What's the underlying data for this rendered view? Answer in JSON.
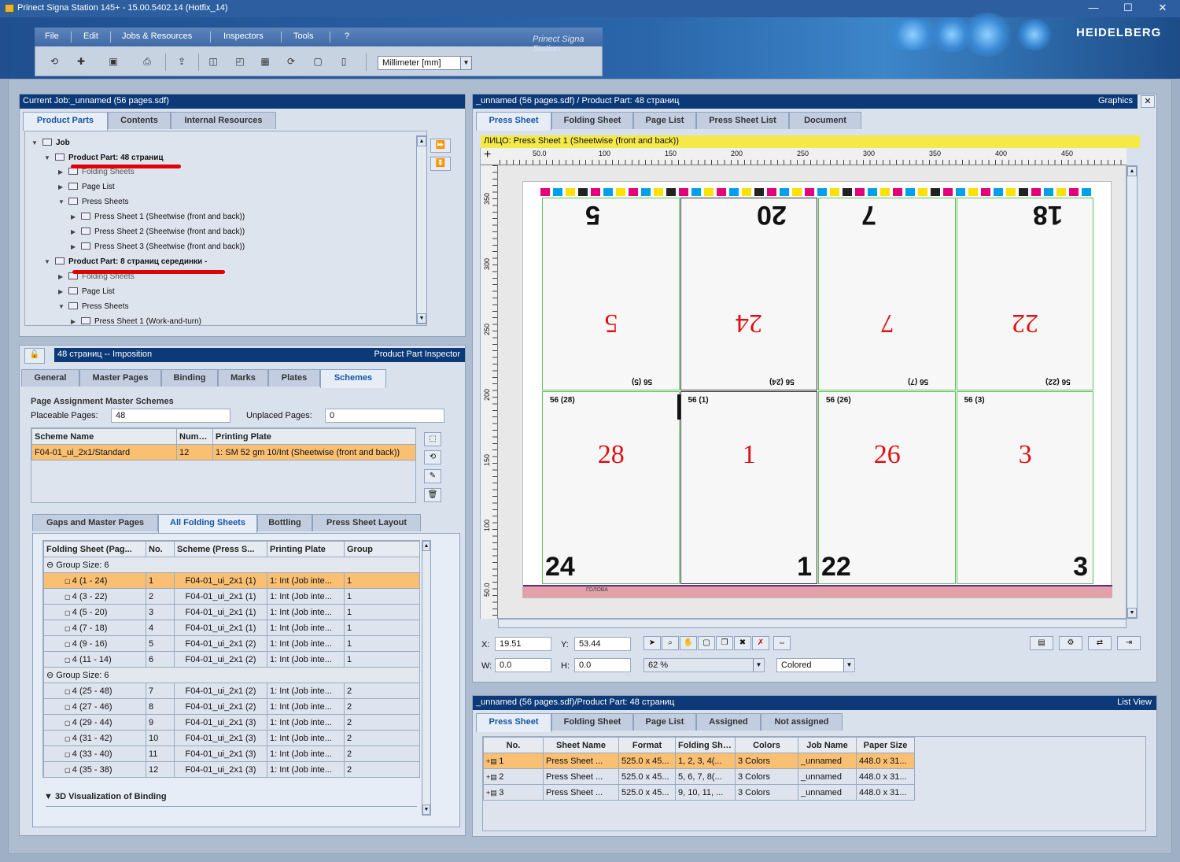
{
  "window": {
    "title": "Prinect Signa Station 145+  -  15.00.5402.14 (Hotfix_14)",
    "minimize": "—",
    "maximize": "☐",
    "close": "✕"
  },
  "brand": {
    "logo": "HEIDELBERG",
    "tagline": "Prinect Signa Station"
  },
  "menu": {
    "items": [
      "File",
      "Edit",
      "Jobs & Resources",
      "Inspectors",
      "Tools",
      "?"
    ]
  },
  "toolbar": {
    "units": "Millimeter  [mm]"
  },
  "job_panel": {
    "title": "Current Job:_unnamed (56 pages.sdf)",
    "tabs": [
      "Product Parts",
      "Contents",
      "Internal Resources"
    ],
    "tree": [
      {
        "label": "Job"
      },
      {
        "label": "Product Part: 48 страниц"
      },
      {
        "label": "Folding Sheets"
      },
      {
        "label": "Page List"
      },
      {
        "label": "Press Sheets"
      },
      {
        "label": "Press Sheet 1 (Sheetwise (front and back))"
      },
      {
        "label": "Press Sheet 2 (Sheetwise (front and back))"
      },
      {
        "label": "Press Sheet 3 (Sheetwise (front and back))"
      },
      {
        "label": "Product Part: 8 страниц серединки -"
      },
      {
        "label": "Folding Sheets"
      },
      {
        "label": "Page List"
      },
      {
        "label": "Press Sheets"
      },
      {
        "label": "Press Sheet 1 (Work-and-turn)"
      }
    ]
  },
  "inspector": {
    "title": "48 страниц -- Imposition",
    "right_title": "Product Part Inspector",
    "tabs": [
      "General",
      "Master Pages",
      "Binding",
      "Marks",
      "Plates",
      "Schemes"
    ],
    "section": "Page Assignment  Master Schemes",
    "placeable_label": "Placeable Pages:",
    "placeable_value": "48",
    "unplaced_label": "Unplaced Pages:",
    "unplaced_value": "0",
    "scheme_headers": [
      "Scheme Name",
      "Number",
      "Printing Plate"
    ],
    "scheme_rows": [
      [
        "F04-01_ui_2x1/Standard",
        "12",
        "1: SM 52 gm 10/Int (Sheetwise (front and back))"
      ]
    ],
    "subtabs": [
      "Gaps and Master Pages",
      "All Folding Sheets",
      "Bottling",
      "Press Sheet Layout"
    ],
    "fs_headers": [
      "Folding Sheet (Pag...",
      "No.",
      "Scheme (Press S...",
      "Printing Plate",
      "Group"
    ],
    "group1": "Group Size: 6",
    "group2": "Group Size: 6",
    "fs_rows1": [
      [
        "4 (1 - 24)",
        "1",
        "F04-01_ui_2x1  (1)",
        "1: Int (Job inte...",
        "1"
      ],
      [
        "4 (3 - 22)",
        "2",
        "F04-01_ui_2x1  (1)",
        "1: Int (Job inte...",
        "1"
      ],
      [
        "4 (5 - 20)",
        "3",
        "F04-01_ui_2x1  (1)",
        "1: Int (Job inte...",
        "1"
      ],
      [
        "4 (7 - 18)",
        "4",
        "F04-01_ui_2x1  (1)",
        "1: Int (Job inte...",
        "1"
      ],
      [
        "4 (9 - 16)",
        "5",
        "F04-01_ui_2x1  (2)",
        "1: Int (Job inte...",
        "1"
      ],
      [
        "4 (11 - 14)",
        "6",
        "F04-01_ui_2x1  (2)",
        "1: Int (Job inte...",
        "1"
      ]
    ],
    "fs_rows2": [
      [
        "4 (25 - 48)",
        "7",
        "F04-01_ui_2x1  (2)",
        "1: Int (Job inte...",
        "2"
      ],
      [
        "4 (27 - 46)",
        "8",
        "F04-01_ui_2x1  (2)",
        "1: Int (Job inte...",
        "2"
      ],
      [
        "4 (29 - 44)",
        "9",
        "F04-01_ui_2x1  (3)",
        "1: Int (Job inte...",
        "2"
      ],
      [
        "4 (31 - 42)",
        "10",
        "F04-01_ui_2x1  (3)",
        "1: Int (Job inte...",
        "2"
      ],
      [
        "4 (33 - 40)",
        "11",
        "F04-01_ui_2x1  (3)",
        "1: Int (Job inte...",
        "2"
      ],
      [
        "4 (35 - 38)",
        "12",
        "F04-01_ui_2x1  (3)",
        "1: Int (Job inte...",
        "2"
      ]
    ],
    "viz_label": "3D Visualization of Binding"
  },
  "graphics": {
    "title": "_unnamed (56 pages.sdf) / Product Part: 48 страниц",
    "right_title": "Graphics",
    "tabs": [
      "Press Sheet",
      "Folding Sheet",
      "Page List",
      "Press Sheet List",
      "Document"
    ],
    "infobar": "ЛИЦО:  Press Sheet 1 (Sheetwise (front and back))",
    "ruler_h": [
      "50.0",
      "100",
      "150",
      "200",
      "250",
      "300",
      "350",
      "400",
      "450"
    ],
    "ruler_v": [
      "350",
      "300",
      "250",
      "200",
      "150",
      "100",
      "50.0"
    ],
    "top_pages": [
      {
        "corner": "5",
        "center": "5",
        "foot": "56 (5)"
      },
      {
        "corner": "20",
        "center": "24",
        "foot": "56 (24)"
      },
      {
        "corner": "7",
        "center": "7",
        "foot": "56 (7)"
      },
      {
        "corner": "18",
        "center": "22",
        "foot": "56 (22)"
      }
    ],
    "bottom_pages": [
      {
        "head": "56 (28)",
        "center": "28",
        "corner": "24"
      },
      {
        "head": "56 (1)",
        "center": "1",
        "corner": "1"
      },
      {
        "head": "56 (26)",
        "center": "26",
        "corner": "22"
      },
      {
        "head": "56 (3)",
        "center": "3",
        "corner": "3"
      }
    ],
    "gripper": "ГОЛОВА",
    "x_label": "X:",
    "x_value": "19.51",
    "y_label": "Y:",
    "y_value": "53.44",
    "w_label": "W:",
    "w_value": "0.0",
    "h_label": "H:",
    "h_value": "0.0",
    "zoom": "62 %",
    "color_mode": "Colored"
  },
  "list_view": {
    "title": "_unnamed (56 pages.sdf)/Product Part: 48 страниц",
    "right_title": "List View",
    "tabs": [
      "Press Sheet",
      "Folding Sheet",
      "Page List",
      "Assigned",
      "Not assigned"
    ],
    "headers": [
      "No.",
      "Sheet Name",
      "Format",
      "Folding Sheet",
      "Colors",
      "Job Name",
      "Paper Size"
    ],
    "rows": [
      [
        "1",
        "Press Sheet ...",
        "525.0 x 45...",
        "1, 2, 3, 4(...",
        "3 Colors",
        "_unnamed",
        "448.0 x 31..."
      ],
      [
        "2",
        "Press Sheet ...",
        "525.0 x 45...",
        "5, 6, 7, 8(...",
        "3 Colors",
        "_unnamed",
        "448.0 x 31..."
      ],
      [
        "3",
        "Press Sheet ...",
        "525.0 x 45...",
        "9, 10, 11, ...",
        "3 Colors",
        "_unnamed",
        "448.0 x 31..."
      ]
    ]
  },
  "colors": {
    "accent": "#0c3a78",
    "selection": "#f9bf73",
    "info": "#f5e94a",
    "page_number": "#d11111"
  }
}
